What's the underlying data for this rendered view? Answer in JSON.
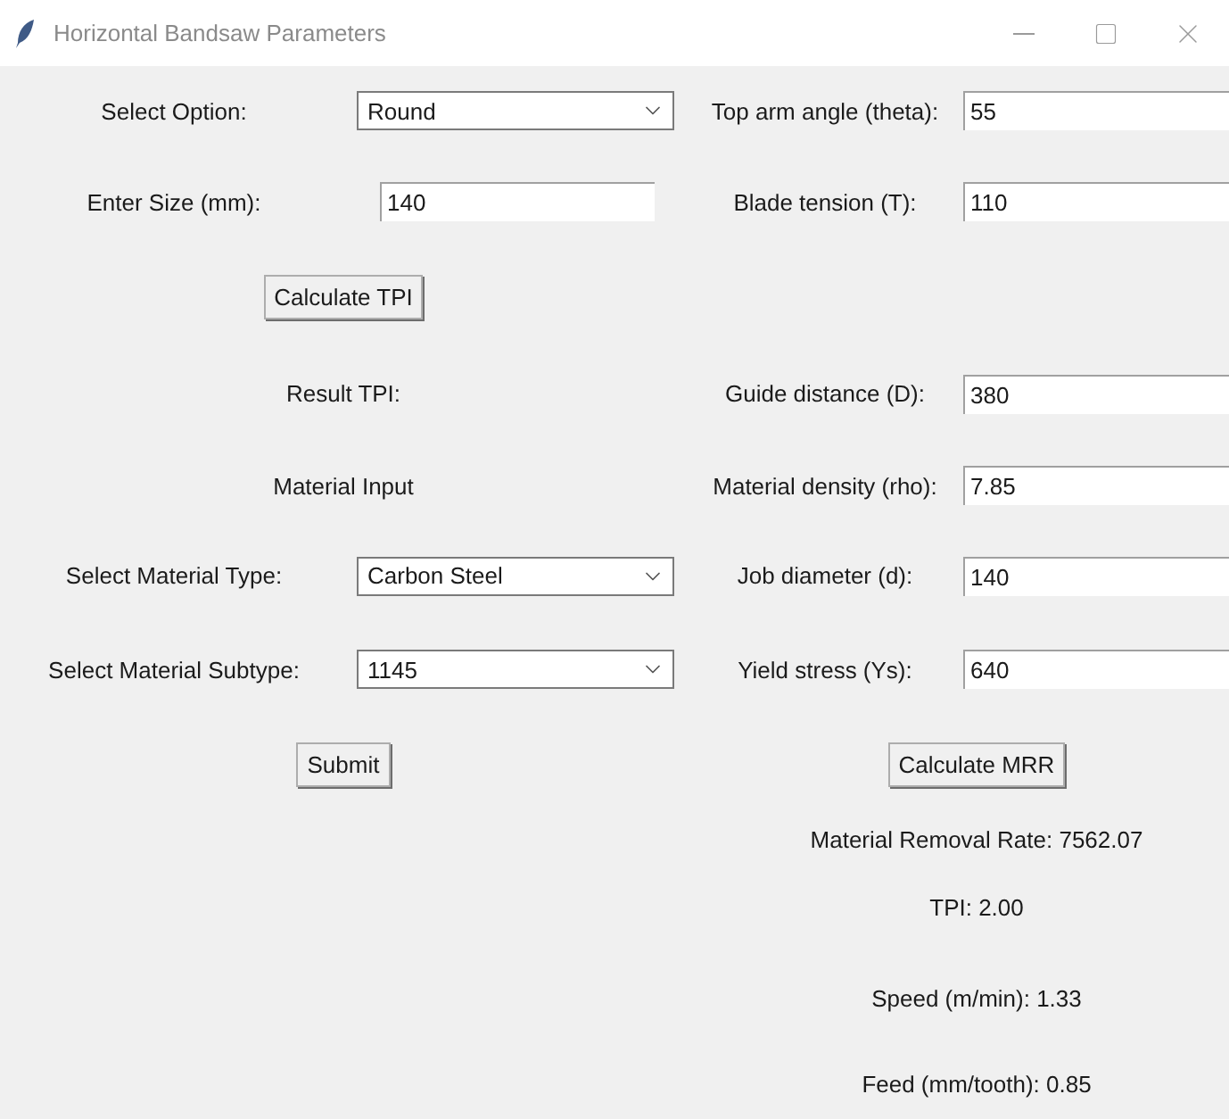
{
  "window": {
    "title": "Horizontal Bandsaw Parameters"
  },
  "shape": {
    "label": "Select Option:",
    "value": "Round"
  },
  "size": {
    "label": "Enter Size (mm):",
    "value": "140"
  },
  "calculate_tpi_button": "Calculate TPI",
  "result_tpi": "Result TPI:",
  "material_section": "Material Input",
  "material_type": {
    "label": "Select Material Type:",
    "value": "Carbon Steel"
  },
  "material_subtype": {
    "label": "Select Material Subtype:",
    "value": "1145"
  },
  "submit_button": "Submit",
  "machine_params": [
    {
      "label": "Top arm angle (theta):",
      "value": "55"
    },
    {
      "label": "Blade tension (T):",
      "value": "110"
    },
    {
      "label": "Guide distance (D):",
      "value": "380"
    },
    {
      "label": "Material density (rho):",
      "value": "7.85"
    },
    {
      "label": "Job diameter (d):",
      "value": "140"
    },
    {
      "label": "Yield stress (Ys):",
      "value": "640"
    }
  ],
  "calculate_mrr_button": "Calculate MRR",
  "results": [
    "Material Removal Rate: 7562.07",
    "TPI: 2.00",
    "Speed (m/min): 1.33",
    "Feed (mm/tooth): 0.85"
  ]
}
